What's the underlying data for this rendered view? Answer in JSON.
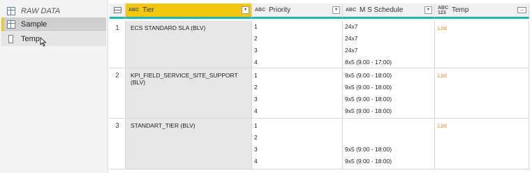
{
  "queries": [
    {
      "label": "RAW DATA",
      "icon": "table-icon"
    },
    {
      "label": "Sample",
      "icon": "table-icon"
    },
    {
      "label": "Temp",
      "icon": "parameter-icon"
    }
  ],
  "columns": {
    "tier": {
      "name": "Tier",
      "type": "ABC"
    },
    "priority": {
      "name": "Priority",
      "type": "ABC"
    },
    "ms": {
      "name": "M S Schedule",
      "type": "ABC"
    },
    "temp": {
      "name": "Temp",
      "type": "ABC 123"
    }
  },
  "rows": [
    {
      "index": "1",
      "tier": "ECS STANDARD SLA (BLV)",
      "priorities": [
        "1",
        "2",
        "3",
        "4"
      ],
      "schedules": [
        "24x7",
        "24x7",
        "24x7",
        "8x5 (9:00 - 17:00)"
      ],
      "temp": "List"
    },
    {
      "index": "2",
      "tier": "KPI_FIELD_SERVICE_SITE_SUPPORT (BLV)",
      "priorities": [
        "1",
        "2",
        "3",
        "4"
      ],
      "schedules": [
        "9x5 (9:00 - 18:00)",
        "9x5 (9:00 - 18:00)",
        "9x5 (9:00 - 18:00)",
        "9x5 (9:00 - 18:00)"
      ],
      "temp": "List"
    },
    {
      "index": "3",
      "tier": "STANDART_TIER (BLV)",
      "priorities": [
        "1",
        "2",
        "3",
        "4"
      ],
      "schedules": [
        "",
        "",
        "9x5 (9:00 - 18:00)",
        "9x5 (9:00 - 18:00)"
      ],
      "temp": "List"
    }
  ],
  "colors": {
    "accent": "#f2c811",
    "header_underline": "#1fb6b1",
    "link": "#e6892e"
  }
}
